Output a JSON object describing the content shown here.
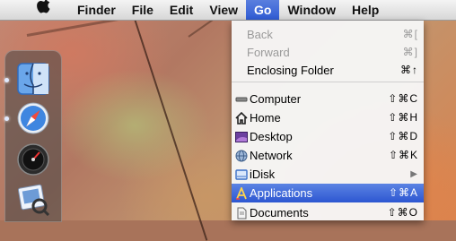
{
  "menubar": {
    "apple_icon": "apple-logo-icon",
    "items": [
      {
        "label": "Finder"
      },
      {
        "label": "File"
      },
      {
        "label": "Edit"
      },
      {
        "label": "View"
      },
      {
        "label": "Go"
      },
      {
        "label": "Window"
      },
      {
        "label": "Help"
      }
    ],
    "active_item": "Go"
  },
  "go_menu": {
    "items": [
      {
        "label": "Back",
        "shortcut": "⌘[",
        "enabled": false
      },
      {
        "label": "Forward",
        "shortcut": "⌘]",
        "enabled": false
      },
      {
        "label": "Enclosing Folder",
        "shortcut": "⌘↑",
        "enabled": true
      },
      {
        "label": "Computer",
        "shortcut": "⇧⌘C",
        "icon": "computer-icon"
      },
      {
        "label": "Home",
        "shortcut": "⇧⌘H",
        "icon": "home-icon"
      },
      {
        "label": "Desktop",
        "shortcut": "⇧⌘D",
        "icon": "desktop-icon"
      },
      {
        "label": "Network",
        "shortcut": "⇧⌘K",
        "icon": "network-icon"
      },
      {
        "label": "iDisk",
        "shortcut": "▶",
        "icon": "idisk-icon"
      },
      {
        "label": "Applications",
        "shortcut": "⇧⌘A",
        "icon": "applications-icon",
        "highlighted": true
      },
      {
        "label": "Documents",
        "shortcut": "⇧⌘O",
        "icon": "documents-icon"
      }
    ]
  },
  "dock": {
    "items": [
      {
        "icon": "finder-icon"
      },
      {
        "icon": "safari-icon"
      },
      {
        "icon": "dashboard-icon"
      },
      {
        "icon": "preview-icon"
      }
    ]
  },
  "colors": {
    "menu_highlight": "#2d57d1",
    "menubar_bg": "#e6e6e6",
    "disabled_text": "#9a9a9a"
  }
}
